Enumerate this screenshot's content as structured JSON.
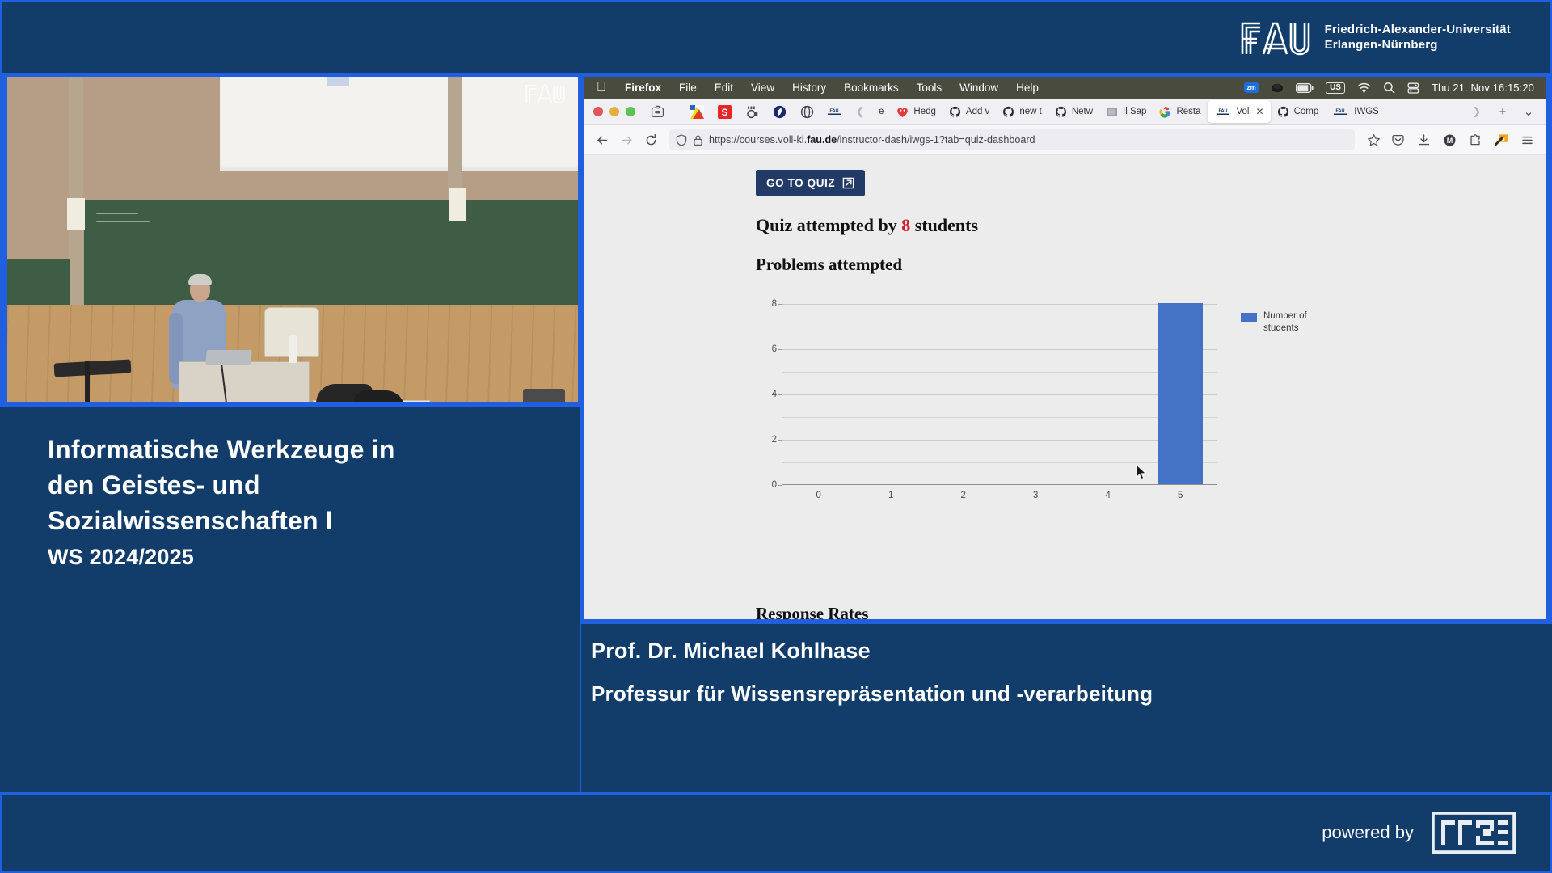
{
  "banner": {
    "university_line1": "Friedrich-Alexander-Universität",
    "university_line2": "Erlangen-Nürnberg",
    "logo_text": "FAU"
  },
  "video": {
    "watermark": "FAU"
  },
  "lecture": {
    "title_line1": "Informatische Werkzeuge in",
    "title_line2": "den Geistes- und",
    "title_line3": "Sozialwissenschaften I",
    "term": "WS 2024/2025"
  },
  "presenter": {
    "name": "Prof. Dr. Michael Kohlhase",
    "role": "Professur für Wissensrepräsentation und -verarbeitung"
  },
  "footer": {
    "powered_by": "powered by",
    "logo_text": "RRZE"
  },
  "macos": {
    "menus": [
      "Firefox",
      "File",
      "Edit",
      "View",
      "History",
      "Bookmarks",
      "Tools",
      "Window",
      "Help"
    ],
    "apple_icon": "apple-icon",
    "status_icons": [
      "zoom-icon",
      "dropbox-icon",
      "battery-icon",
      "keyboard-layout-icon",
      "wifi-icon",
      "spotlight-search-icon",
      "control-center-icon"
    ],
    "keyboard_layout": "US",
    "zoom_badge": "zm",
    "clock": "Thu 21. Nov  16:15:20"
  },
  "browser": {
    "window_controls": [
      "close-button",
      "minimize-button",
      "zoom-button"
    ],
    "sidebar_icon": "firefox-view-icon",
    "pinned_tabs": [
      {
        "name": "pinned-tab-1",
        "icon": "colorful-app-icon"
      },
      {
        "name": "pinned-tab-2",
        "icon": "red-s-icon"
      },
      {
        "name": "pinned-tab-3",
        "icon": "grey-app-icon"
      },
      {
        "name": "pinned-tab-4",
        "icon": "dark-blue-app-icon"
      },
      {
        "name": "pinned-tab-5",
        "icon": "globe-icon"
      },
      {
        "name": "pinned-tab-6",
        "icon": "fau-icon"
      }
    ],
    "scroll_left_icon": "chevron-left-icon",
    "tabs": [
      {
        "label": "e",
        "icon": "generic-icon",
        "active": false
      },
      {
        "label": "Hedg",
        "icon": "hedgedoc-icon",
        "active": false
      },
      {
        "label": "Add v",
        "icon": "github-icon",
        "active": false
      },
      {
        "label": "new t",
        "icon": "github-icon",
        "active": false
      },
      {
        "label": "Netw",
        "icon": "github-icon",
        "active": false
      },
      {
        "label": "Il Sap",
        "icon": "grey-thumbnail-icon",
        "active": false
      },
      {
        "label": "Resta",
        "icon": "google-icon",
        "active": false
      },
      {
        "label": "Vol",
        "icon": "fau-icon",
        "active": true
      },
      {
        "label": "Comp",
        "icon": "github-icon",
        "active": false
      },
      {
        "label": "IWGS",
        "icon": "fau-icon",
        "active": false
      }
    ],
    "tabstrip_end_icons": [
      "list-all-tabs-chevron-icon",
      "new-tab-plus-icon",
      "tab-dropdown-chevron-icon"
    ],
    "nav": {
      "back_icon": "arrow-left-icon",
      "forward_icon": "arrow-right-icon",
      "reload_icon": "reload-icon"
    },
    "urlbar": {
      "shield_icon": "shield-icon",
      "lock_icon": "padlock-icon",
      "url_prefix": "https://courses.voll-ki.",
      "url_domain": "fau.de",
      "url_suffix": "/instructor-dash/iwgs-1?tab=quiz-dashboard",
      "bookmark_icon": "star-icon"
    },
    "toolbar_icons": [
      "pocket-icon",
      "downloads-icon",
      "account-avatar-icon",
      "extensions-puzzle-icon",
      "annotate-extension-icon",
      "app-menu-hamburger-icon"
    ],
    "avatar_letter": "M"
  },
  "dashboard": {
    "goto_quiz_label": "GO TO QUIZ",
    "goto_quiz_icon": "external-link-icon",
    "attempted_prefix": "Quiz attempted by",
    "attempted_count": "8",
    "attempted_suffix": "students",
    "problems_heading": "Problems attempted",
    "response_rates_heading": "Response Rates",
    "cursor_icon": "mouse-pointer-icon"
  },
  "colors": {
    "navy": "#123d6b",
    "accent_blue": "#1f5fe0",
    "bar_blue": "#4472c4",
    "button_navy": "#223a66",
    "count_red": "#cf1f2e"
  },
  "chart_data": {
    "type": "bar",
    "title": "Problems attempted",
    "xlabel": "",
    "ylabel": "",
    "categories": [
      "0",
      "1",
      "2",
      "3",
      "4",
      "5"
    ],
    "values": [
      0,
      0,
      0,
      0,
      0,
      8
    ],
    "ylim": [
      0,
      8
    ],
    "yticks": [
      0,
      2,
      4,
      6,
      8
    ],
    "minor_gridlines": [
      1,
      3,
      5,
      7
    ],
    "grid": true,
    "legend_position": "right",
    "series": [
      {
        "name": "Number of students",
        "values": [
          0,
          0,
          0,
          0,
          0,
          8
        ],
        "color": "#4472c4"
      }
    ]
  }
}
